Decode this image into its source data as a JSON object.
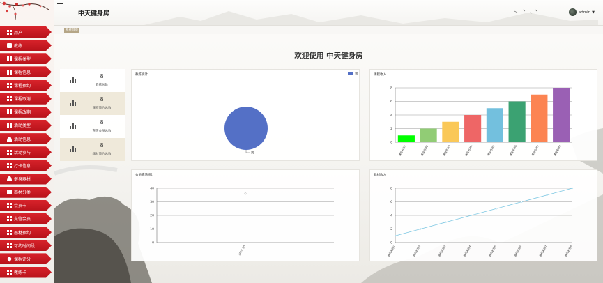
{
  "app": {
    "title": "中天健身房",
    "user": "admin"
  },
  "breadcrumb": "系统首页",
  "welcome": "欢迎使用 中天健身房",
  "sidebar": {
    "items": [
      {
        "label": "用户",
        "icon": "grid-icon"
      },
      {
        "label": "教练",
        "icon": "card-icon"
      },
      {
        "label": "课程类型",
        "icon": "grid-icon"
      },
      {
        "label": "课程信息",
        "icon": "grid-icon"
      },
      {
        "label": "课程预约",
        "icon": "grid-icon"
      },
      {
        "label": "课程取消",
        "icon": "grid-icon"
      },
      {
        "label": "课程改期",
        "icon": "grid-icon"
      },
      {
        "label": "活动类型",
        "icon": "grid-icon"
      },
      {
        "label": "活动信息",
        "icon": "user-icon"
      },
      {
        "label": "活动参与",
        "icon": "grid-icon"
      },
      {
        "label": "打卡信息",
        "icon": "grid-icon"
      },
      {
        "label": "健身器材",
        "icon": "user-icon"
      },
      {
        "label": "器材分类",
        "icon": "card-icon"
      },
      {
        "label": "会员卡",
        "icon": "grid-icon"
      },
      {
        "label": "充值会员",
        "icon": "grid-icon"
      },
      {
        "label": "器材预约",
        "icon": "grid-icon"
      },
      {
        "label": "可约时间段",
        "icon": "grid-icon"
      },
      {
        "label": "课程评分",
        "icon": "pin-icon"
      },
      {
        "label": "教练卡",
        "icon": "grid-icon"
      }
    ]
  },
  "stats": [
    {
      "value": "8",
      "label": "教练总数"
    },
    {
      "value": "8",
      "label": "课程预约总数"
    },
    {
      "value": "8",
      "label": "充值会员总数"
    },
    {
      "value": "8",
      "label": "器材预约总数"
    }
  ],
  "panels": {
    "coach": "教练统计",
    "course_income": "课程收入",
    "member": "会员充值统计",
    "equipment_income": "器材收入"
  },
  "colors": {
    "sidebar_red": "#c81d25",
    "pie_blue": "#5470c6",
    "line_blue": "#7ec8e3",
    "crumb_tan": "#b5a687"
  },
  "chart_data": [
    {
      "type": "pie",
      "title": "教练统计",
      "legend": "top-right",
      "slices": [
        {
          "name": "男",
          "value": 8
        }
      ]
    },
    {
      "type": "bar",
      "title": "课程收入",
      "categories": [
        "课程名称1",
        "课程名称2",
        "课程名称3",
        "课程名称4",
        "课程名称5",
        "课程名称6",
        "课程名称7",
        "课程名称8"
      ],
      "values": [
        1,
        2,
        3,
        4,
        5,
        6,
        7,
        8
      ],
      "colors": [
        "#00ff00",
        "#91cc75",
        "#fac858",
        "#ee6666",
        "#73c0de",
        "#3ba272",
        "#fc8452",
        "#9a60b4"
      ],
      "ylim": [
        0,
        8
      ],
      "yticks": [
        0,
        2,
        4,
        6,
        8
      ],
      "grid": true
    },
    {
      "type": "scatter",
      "title": "会员充值统计",
      "categories": [
        "2024-10"
      ],
      "values": [
        36
      ],
      "ylim": [
        0,
        40
      ],
      "yticks": [
        0,
        10,
        20,
        30,
        40
      ],
      "grid": true
    },
    {
      "type": "line",
      "title": "器材收入",
      "categories": [
        "器材名称1",
        "器材名称2",
        "器材名称3",
        "器材名称4",
        "器材名称5",
        "器材名称6",
        "器材名称7",
        "器材名称8"
      ],
      "values": [
        1,
        2,
        3,
        4,
        5,
        6,
        7,
        8
      ],
      "ylim": [
        0,
        8
      ],
      "yticks": [
        0,
        2,
        4,
        6,
        8
      ],
      "grid": true
    }
  ]
}
